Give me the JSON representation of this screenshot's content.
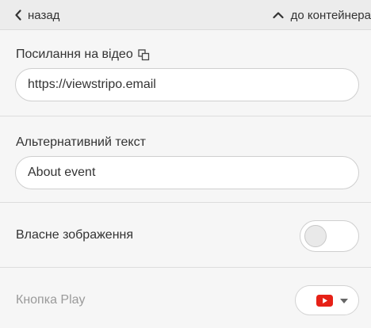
{
  "topbar": {
    "back_label": "назад",
    "container_label": "до контейнера"
  },
  "video_link": {
    "label": "Посилання на відео",
    "value": "https://viewstripo.email"
  },
  "alt_text": {
    "label": "Альтернативний текст",
    "value": "About event"
  },
  "own_image": {
    "label": "Власне зображення",
    "enabled": false
  },
  "play_button": {
    "label": "Кнопка Play",
    "selected_icon": "youtube-play-icon"
  },
  "colors": {
    "background": "#f6f6f6",
    "topbar": "#ececec",
    "youtube_red": "#e62117",
    "disabled_text": "#9a9a9a"
  }
}
